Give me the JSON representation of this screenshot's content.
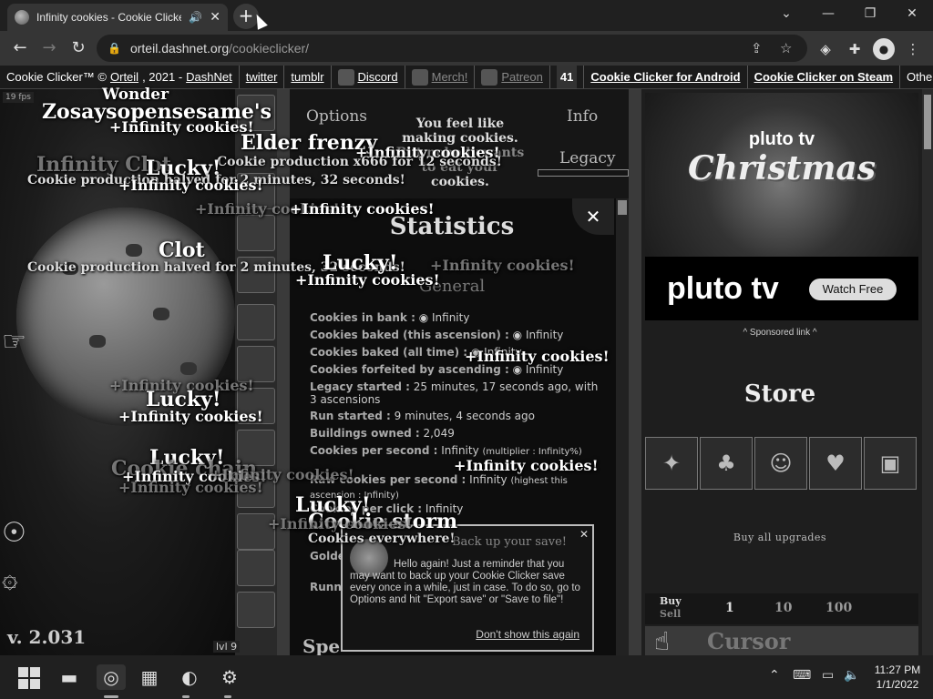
{
  "browser": {
    "tab_title": "Infinity cookies - Cookie Clicker",
    "url_domain": "orteil.dashnet.org",
    "url_path": "/cookieclicker/",
    "icons": [
      "back-icon",
      "forward-icon",
      "reload-icon",
      "lock-icon",
      "share-icon",
      "star-icon",
      "extensions-icon",
      "profile-icon",
      "menu-icon"
    ]
  },
  "topbar": {
    "brand": "Cookie Clicker™ ©",
    "author": "Orteil",
    "year_sep": ", 2021 -",
    "site": "DashNet",
    "links": [
      "twitter",
      "tumblr",
      "Discord",
      "Merch!",
      "Patreon"
    ],
    "badge": "41",
    "android": "Cookie Clicker for Android",
    "steam": "Cookie Clicker on Steam",
    "versions": "Other versions"
  },
  "game": {
    "fps": "19 fps",
    "version": "v. 2.031",
    "level": "lvl 9",
    "menu": {
      "options": "Options",
      "info": "Info",
      "legacy": "Legacy"
    },
    "menu_message": [
      "You feel like",
      "making cookies.",
      "But nobody wants",
      "to eat your",
      "cookies."
    ],
    "stats": {
      "title": "Statistics",
      "section": "General",
      "rows": [
        {
          "label": "Cookies in bank :",
          "value": "Infinity"
        },
        {
          "label": "Cookies baked (this ascension) :",
          "value": "Infinity"
        },
        {
          "label": "Cookies baked (all time) :",
          "value": "Infinity"
        },
        {
          "label": "Cookies forfeited by ascending :",
          "value": "Infinity"
        },
        {
          "label": "Legacy started :",
          "value": "25 minutes, 17 seconds ago, with 3 ascensions"
        },
        {
          "label": "Run started :",
          "value": "9 minutes, 4 seconds ago"
        },
        {
          "label": "Buildings owned :",
          "value": "2,049"
        },
        {
          "label": "Cookies per second :",
          "value": "Infinity",
          "note": "(multiplier : Infinity%)"
        },
        {
          "label": "Raw cookies per second :",
          "value": "Infinity",
          "note": "(highest this ascension : Infinity)"
        },
        {
          "label": "Cookies per click :",
          "value": "Infinity"
        },
        {
          "label": "Golden cookie clicks :",
          "value": ""
        },
        {
          "label": "Running version :",
          "value": ""
        }
      ],
      "special": "Spe"
    },
    "notification": {
      "title": "Back up your save!",
      "body": "Hello again! Just a reminder that you may want to back up your Cookie Clicker save every once in a while, just in case. To do so, go to Options and hit \"Export save\" or \"Save to file\"!",
      "link": "Don't show this again"
    }
  },
  "overlays": {
    "wonder": "Wonder",
    "zosay": "Zosaysopensesame's",
    "gain": "+Infinity cookies!",
    "elder": "Elder frenzy",
    "infinity_clot": "Infinity Clot",
    "lucky": "Lucky!",
    "clot": "Clot",
    "clot_msg": "Cookie production halved for 2 minutes, 32 seconds!",
    "frenzy_msg": "Cookie production x666 for 12 seconds!",
    "storm": "Cookie storm",
    "storm_msg": "Cookies everywhere!",
    "cookie_chain": "Cookie chain"
  },
  "store": {
    "ad_brand_top": "pluto tv",
    "ad_title": "Christmas",
    "ad_brand": "pluto tv",
    "ad_button": "Watch Free",
    "sponsored": "^ Sponsored link ^",
    "title": "Store",
    "buy_all": "Buy all upgrades",
    "buy": "Buy",
    "sell": "Sell",
    "amounts": [
      "1",
      "10",
      "100"
    ],
    "first_building": "Cursor"
  },
  "taskbar": {
    "time": "11:27 PM",
    "date": "1/1/2022"
  }
}
